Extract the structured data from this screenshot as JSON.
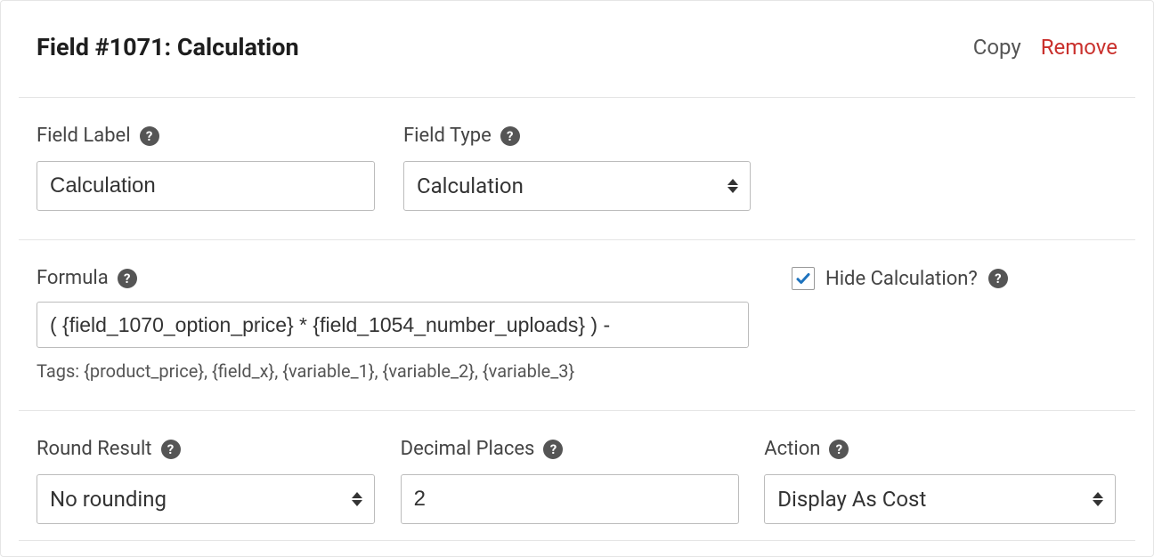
{
  "header": {
    "title": "Field #1071: Calculation",
    "copy": "Copy",
    "remove": "Remove"
  },
  "fieldLabel": {
    "label": "Field Label",
    "value": "Calculation"
  },
  "fieldType": {
    "label": "Field Type",
    "value": "Calculation"
  },
  "formula": {
    "label": "Formula",
    "value": "( {field_1070_option_price} * {field_1054_number_uploads} ) -",
    "tags": "Tags: {product_price}, {field_x}, {variable_1}, {variable_2}, {variable_3}"
  },
  "hideCalc": {
    "label": "Hide Calculation?",
    "checked": true
  },
  "roundResult": {
    "label": "Round Result",
    "value": "No rounding"
  },
  "decimalPlaces": {
    "label": "Decimal Places",
    "value": "2"
  },
  "action": {
    "label": "Action",
    "value": "Display As Cost"
  }
}
